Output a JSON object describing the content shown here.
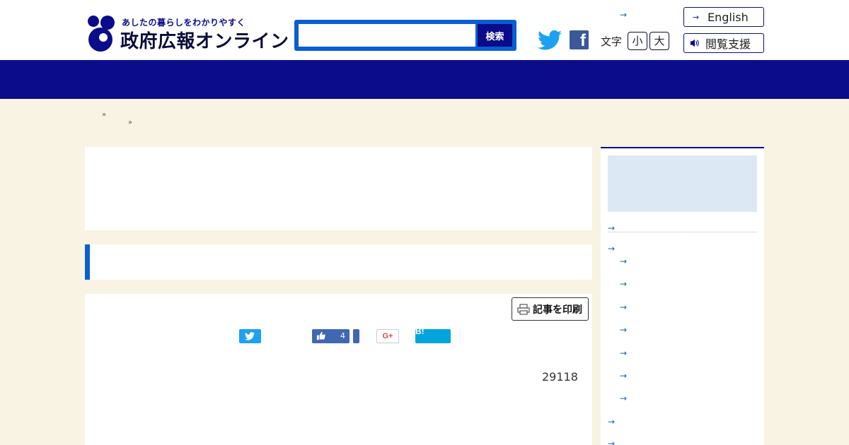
{
  "header": {
    "logo": {
      "tagline": "あしたの暮らしをわかりやすく",
      "title": "政府広報オンライン"
    },
    "search": {
      "placeholder": "",
      "button_label": "検索"
    },
    "social": {
      "twitter_icon": "twitter-icon",
      "facebook_icon": "facebook-icon",
      "facebook_glyph": "f"
    },
    "font_size": {
      "label": "文字",
      "small": "小",
      "large": "大"
    },
    "top_link_arrow": "→",
    "english_button": {
      "icon": "→",
      "label": "English"
    },
    "accessibility_button": {
      "icon": "🔊",
      "label": "閲覧支援"
    }
  },
  "colors": {
    "navy": "#0a0c8b",
    "blue": "#0a5fd0",
    "page_bg": "#f8f3e2",
    "sidebar_banner": "#dde8f5"
  },
  "breadcrumb": {
    "sep1": "»",
    "sep2": "»"
  },
  "article": {
    "print_button": "記事を印刷",
    "share": {
      "like_count": "4",
      "gplus_label": "G+",
      "hatena_label": "B!"
    },
    "count": "29118"
  },
  "sidebar": {
    "arrow": "→"
  }
}
